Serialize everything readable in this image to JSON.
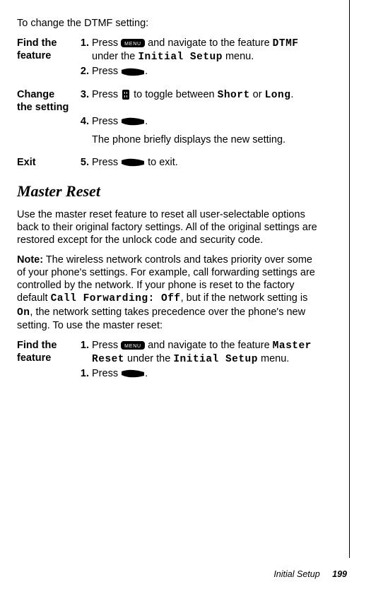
{
  "intro": "To change the DTMF setting:",
  "sec1": {
    "label_find": "Find the feature",
    "label_change": "Change the setting",
    "label_exit": "Exit",
    "s1": {
      "n": "1.",
      "a": "Press ",
      "b": " and navigate to the feature ",
      "c": " under the ",
      "d": " menu."
    },
    "s2": {
      "n": "2.",
      "a": "Press ",
      "b": "."
    },
    "s3": {
      "n": "3.",
      "a": "Press ",
      "b": " to toggle between ",
      "c": " or ",
      "d": "."
    },
    "s4": {
      "n": "4.",
      "a": "Press ",
      "b": "."
    },
    "s4_note": "The phone briefly displays the new setting.",
    "s5": {
      "n": "5.",
      "a": "Press ",
      "b": " to exit."
    }
  },
  "ui": {
    "dtmf": "DTMF",
    "initial_setup": "Initial Setup",
    "short": "Short",
    "long": "Long",
    "call_fwd_off": "Call Forwarding: Off",
    "on": "On",
    "master_reset": "Master Reset"
  },
  "heading": "Master Reset",
  "para1_a": "Use the master reset feature to reset all user-selectable options back to their original factory settings. All of the original settings are restored except for the unlock code and security code.",
  "para2_a": "Note:",
  "para2_b": " The wireless network controls and takes priority over some of your phone's settings. For example, call forwarding settings are controlled by the network. If your phone is reset to the factory default ",
  "para2_c": ", but if the network setting is ",
  "para2_d": ", the network setting takes precedence over the phone's new setting. To use the master reset:",
  "sec2": {
    "label_find": "Find the feature",
    "s1": {
      "n": "1.",
      "a": "Press ",
      "b": " and navigate to the feature ",
      "c": " under the ",
      "d": " menu."
    },
    "s2": {
      "n": "1.",
      "a": "Press ",
      "b": "."
    }
  },
  "footer_label": "Initial Setup",
  "footer_page": "199"
}
